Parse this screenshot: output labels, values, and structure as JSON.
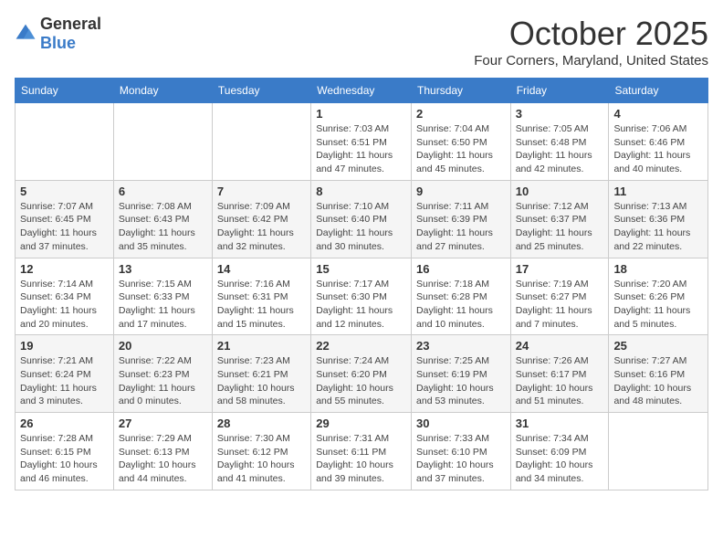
{
  "logo": {
    "general": "General",
    "blue": "Blue"
  },
  "title": "October 2025",
  "location": "Four Corners, Maryland, United States",
  "days_of_week": [
    "Sunday",
    "Monday",
    "Tuesday",
    "Wednesday",
    "Thursday",
    "Friday",
    "Saturday"
  ],
  "weeks": [
    [
      {
        "day": "",
        "info": ""
      },
      {
        "day": "",
        "info": ""
      },
      {
        "day": "",
        "info": ""
      },
      {
        "day": "1",
        "info": "Sunrise: 7:03 AM\nSunset: 6:51 PM\nDaylight: 11 hours and 47 minutes."
      },
      {
        "day": "2",
        "info": "Sunrise: 7:04 AM\nSunset: 6:50 PM\nDaylight: 11 hours and 45 minutes."
      },
      {
        "day": "3",
        "info": "Sunrise: 7:05 AM\nSunset: 6:48 PM\nDaylight: 11 hours and 42 minutes."
      },
      {
        "day": "4",
        "info": "Sunrise: 7:06 AM\nSunset: 6:46 PM\nDaylight: 11 hours and 40 minutes."
      }
    ],
    [
      {
        "day": "5",
        "info": "Sunrise: 7:07 AM\nSunset: 6:45 PM\nDaylight: 11 hours and 37 minutes."
      },
      {
        "day": "6",
        "info": "Sunrise: 7:08 AM\nSunset: 6:43 PM\nDaylight: 11 hours and 35 minutes."
      },
      {
        "day": "7",
        "info": "Sunrise: 7:09 AM\nSunset: 6:42 PM\nDaylight: 11 hours and 32 minutes."
      },
      {
        "day": "8",
        "info": "Sunrise: 7:10 AM\nSunset: 6:40 PM\nDaylight: 11 hours and 30 minutes."
      },
      {
        "day": "9",
        "info": "Sunrise: 7:11 AM\nSunset: 6:39 PM\nDaylight: 11 hours and 27 minutes."
      },
      {
        "day": "10",
        "info": "Sunrise: 7:12 AM\nSunset: 6:37 PM\nDaylight: 11 hours and 25 minutes."
      },
      {
        "day": "11",
        "info": "Sunrise: 7:13 AM\nSunset: 6:36 PM\nDaylight: 11 hours and 22 minutes."
      }
    ],
    [
      {
        "day": "12",
        "info": "Sunrise: 7:14 AM\nSunset: 6:34 PM\nDaylight: 11 hours and 20 minutes."
      },
      {
        "day": "13",
        "info": "Sunrise: 7:15 AM\nSunset: 6:33 PM\nDaylight: 11 hours and 17 minutes."
      },
      {
        "day": "14",
        "info": "Sunrise: 7:16 AM\nSunset: 6:31 PM\nDaylight: 11 hours and 15 minutes."
      },
      {
        "day": "15",
        "info": "Sunrise: 7:17 AM\nSunset: 6:30 PM\nDaylight: 11 hours and 12 minutes."
      },
      {
        "day": "16",
        "info": "Sunrise: 7:18 AM\nSunset: 6:28 PM\nDaylight: 11 hours and 10 minutes."
      },
      {
        "day": "17",
        "info": "Sunrise: 7:19 AM\nSunset: 6:27 PM\nDaylight: 11 hours and 7 minutes."
      },
      {
        "day": "18",
        "info": "Sunrise: 7:20 AM\nSunset: 6:26 PM\nDaylight: 11 hours and 5 minutes."
      }
    ],
    [
      {
        "day": "19",
        "info": "Sunrise: 7:21 AM\nSunset: 6:24 PM\nDaylight: 11 hours and 3 minutes."
      },
      {
        "day": "20",
        "info": "Sunrise: 7:22 AM\nSunset: 6:23 PM\nDaylight: 11 hours and 0 minutes."
      },
      {
        "day": "21",
        "info": "Sunrise: 7:23 AM\nSunset: 6:21 PM\nDaylight: 10 hours and 58 minutes."
      },
      {
        "day": "22",
        "info": "Sunrise: 7:24 AM\nSunset: 6:20 PM\nDaylight: 10 hours and 55 minutes."
      },
      {
        "day": "23",
        "info": "Sunrise: 7:25 AM\nSunset: 6:19 PM\nDaylight: 10 hours and 53 minutes."
      },
      {
        "day": "24",
        "info": "Sunrise: 7:26 AM\nSunset: 6:17 PM\nDaylight: 10 hours and 51 minutes."
      },
      {
        "day": "25",
        "info": "Sunrise: 7:27 AM\nSunset: 6:16 PM\nDaylight: 10 hours and 48 minutes."
      }
    ],
    [
      {
        "day": "26",
        "info": "Sunrise: 7:28 AM\nSunset: 6:15 PM\nDaylight: 10 hours and 46 minutes."
      },
      {
        "day": "27",
        "info": "Sunrise: 7:29 AM\nSunset: 6:13 PM\nDaylight: 10 hours and 44 minutes."
      },
      {
        "day": "28",
        "info": "Sunrise: 7:30 AM\nSunset: 6:12 PM\nDaylight: 10 hours and 41 minutes."
      },
      {
        "day": "29",
        "info": "Sunrise: 7:31 AM\nSunset: 6:11 PM\nDaylight: 10 hours and 39 minutes."
      },
      {
        "day": "30",
        "info": "Sunrise: 7:33 AM\nSunset: 6:10 PM\nDaylight: 10 hours and 37 minutes."
      },
      {
        "day": "31",
        "info": "Sunrise: 7:34 AM\nSunset: 6:09 PM\nDaylight: 10 hours and 34 minutes."
      },
      {
        "day": "",
        "info": ""
      }
    ]
  ]
}
